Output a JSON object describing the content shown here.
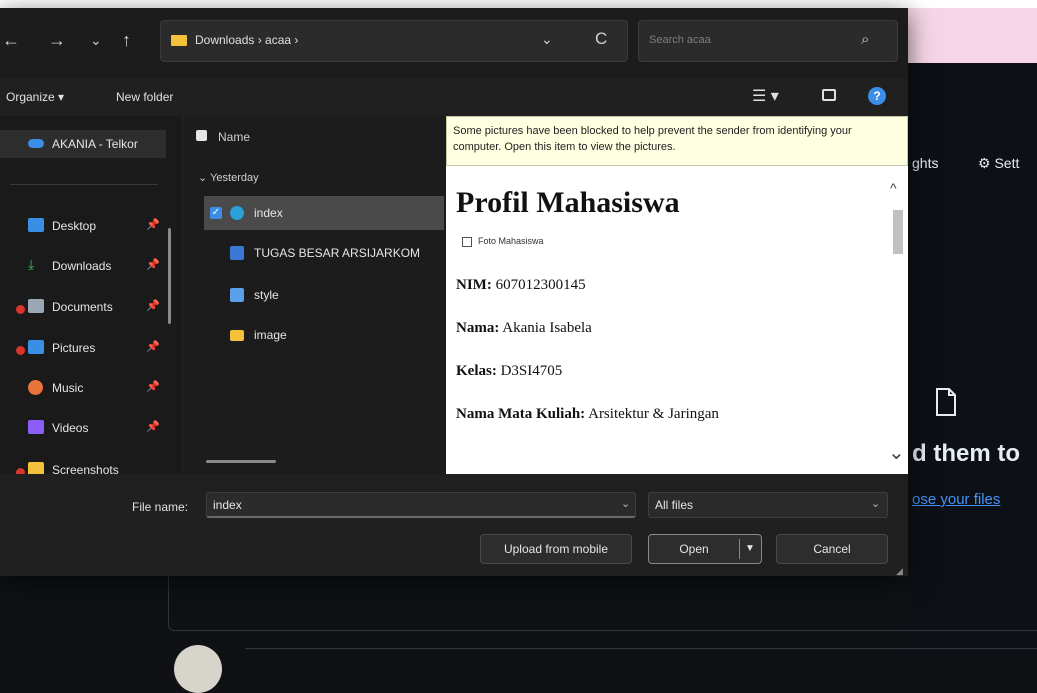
{
  "background": {
    "nav_insights": "ghts",
    "nav_settings": "Sett",
    "drop_text": "d them to",
    "choose_link": "ose your files"
  },
  "dialog": {
    "nav": {
      "back": "←",
      "forward": "→",
      "recent": "⌄",
      "up": "↑",
      "address": "Downloads › acaa ›",
      "address_chevron": "⌄",
      "refresh": "C",
      "search_placeholder": "Search acaa"
    },
    "toolbar": {
      "organize": "Organize ▾",
      "new_folder": "New folder",
      "view": "☰ ▾",
      "help": "?"
    },
    "sidebar": {
      "items": [
        {
          "label": "AKANIA - Telkor",
          "icon_color": "#3a8ee6"
        },
        {
          "label": "Desktop",
          "icon_color": "#3a8ee6",
          "pinned": true
        },
        {
          "label": "Downloads",
          "icon_color": "#3fb950",
          "pinned": true
        },
        {
          "label": "Documents",
          "icon_color": "#9aa7b5",
          "pinned": true,
          "badge": true
        },
        {
          "label": "Pictures",
          "icon_color": "#3a8ee6",
          "pinned": true,
          "badge": true
        },
        {
          "label": "Music",
          "icon_color": "#e8743b",
          "pinned": true
        },
        {
          "label": "Videos",
          "icon_color": "#8b5cf6",
          "pinned": true
        },
        {
          "label": "Screenshots",
          "icon_color": "#f3c13a",
          "badge": true
        }
      ],
      "pin_glyph": "📌"
    },
    "file_list": {
      "column_name": "Name",
      "group": "Yesterday",
      "files": [
        {
          "name": "index",
          "icon_color": "#2a9fd8",
          "selected": true
        },
        {
          "name": "TUGAS BESAR ARSIJARKOM",
          "icon_color": "#3a78d8"
        },
        {
          "name": "style",
          "icon_color": "#5aa0e8"
        },
        {
          "name": "image",
          "icon_color": "#f3c13a"
        }
      ]
    },
    "preview": {
      "notice": "Some pictures have been blocked to help prevent the sender from identifying your computer. Open this item to view the pictures.",
      "title": "Profil Mahasiswa",
      "image_alt": "Foto Mahasiswa",
      "fields": [
        {
          "label": "NIM:",
          "value": "607012300145"
        },
        {
          "label": "Nama:",
          "value": "Akania Isabela"
        },
        {
          "label": "Kelas:",
          "value": "D3SI4705"
        },
        {
          "label": "Nama Mata Kuliah:",
          "value": "Arsitektur & Jaringan"
        }
      ]
    },
    "bottom": {
      "file_name_label": "File name:",
      "file_name_value": "index",
      "filter_value": "All files",
      "upload_label": "Upload from mobile",
      "open_label": "Open",
      "cancel_label": "Cancel"
    }
  },
  "colors": {
    "accent": "#3a8ee6",
    "link": "#4493f8",
    "badge_red": "#d9342b"
  }
}
